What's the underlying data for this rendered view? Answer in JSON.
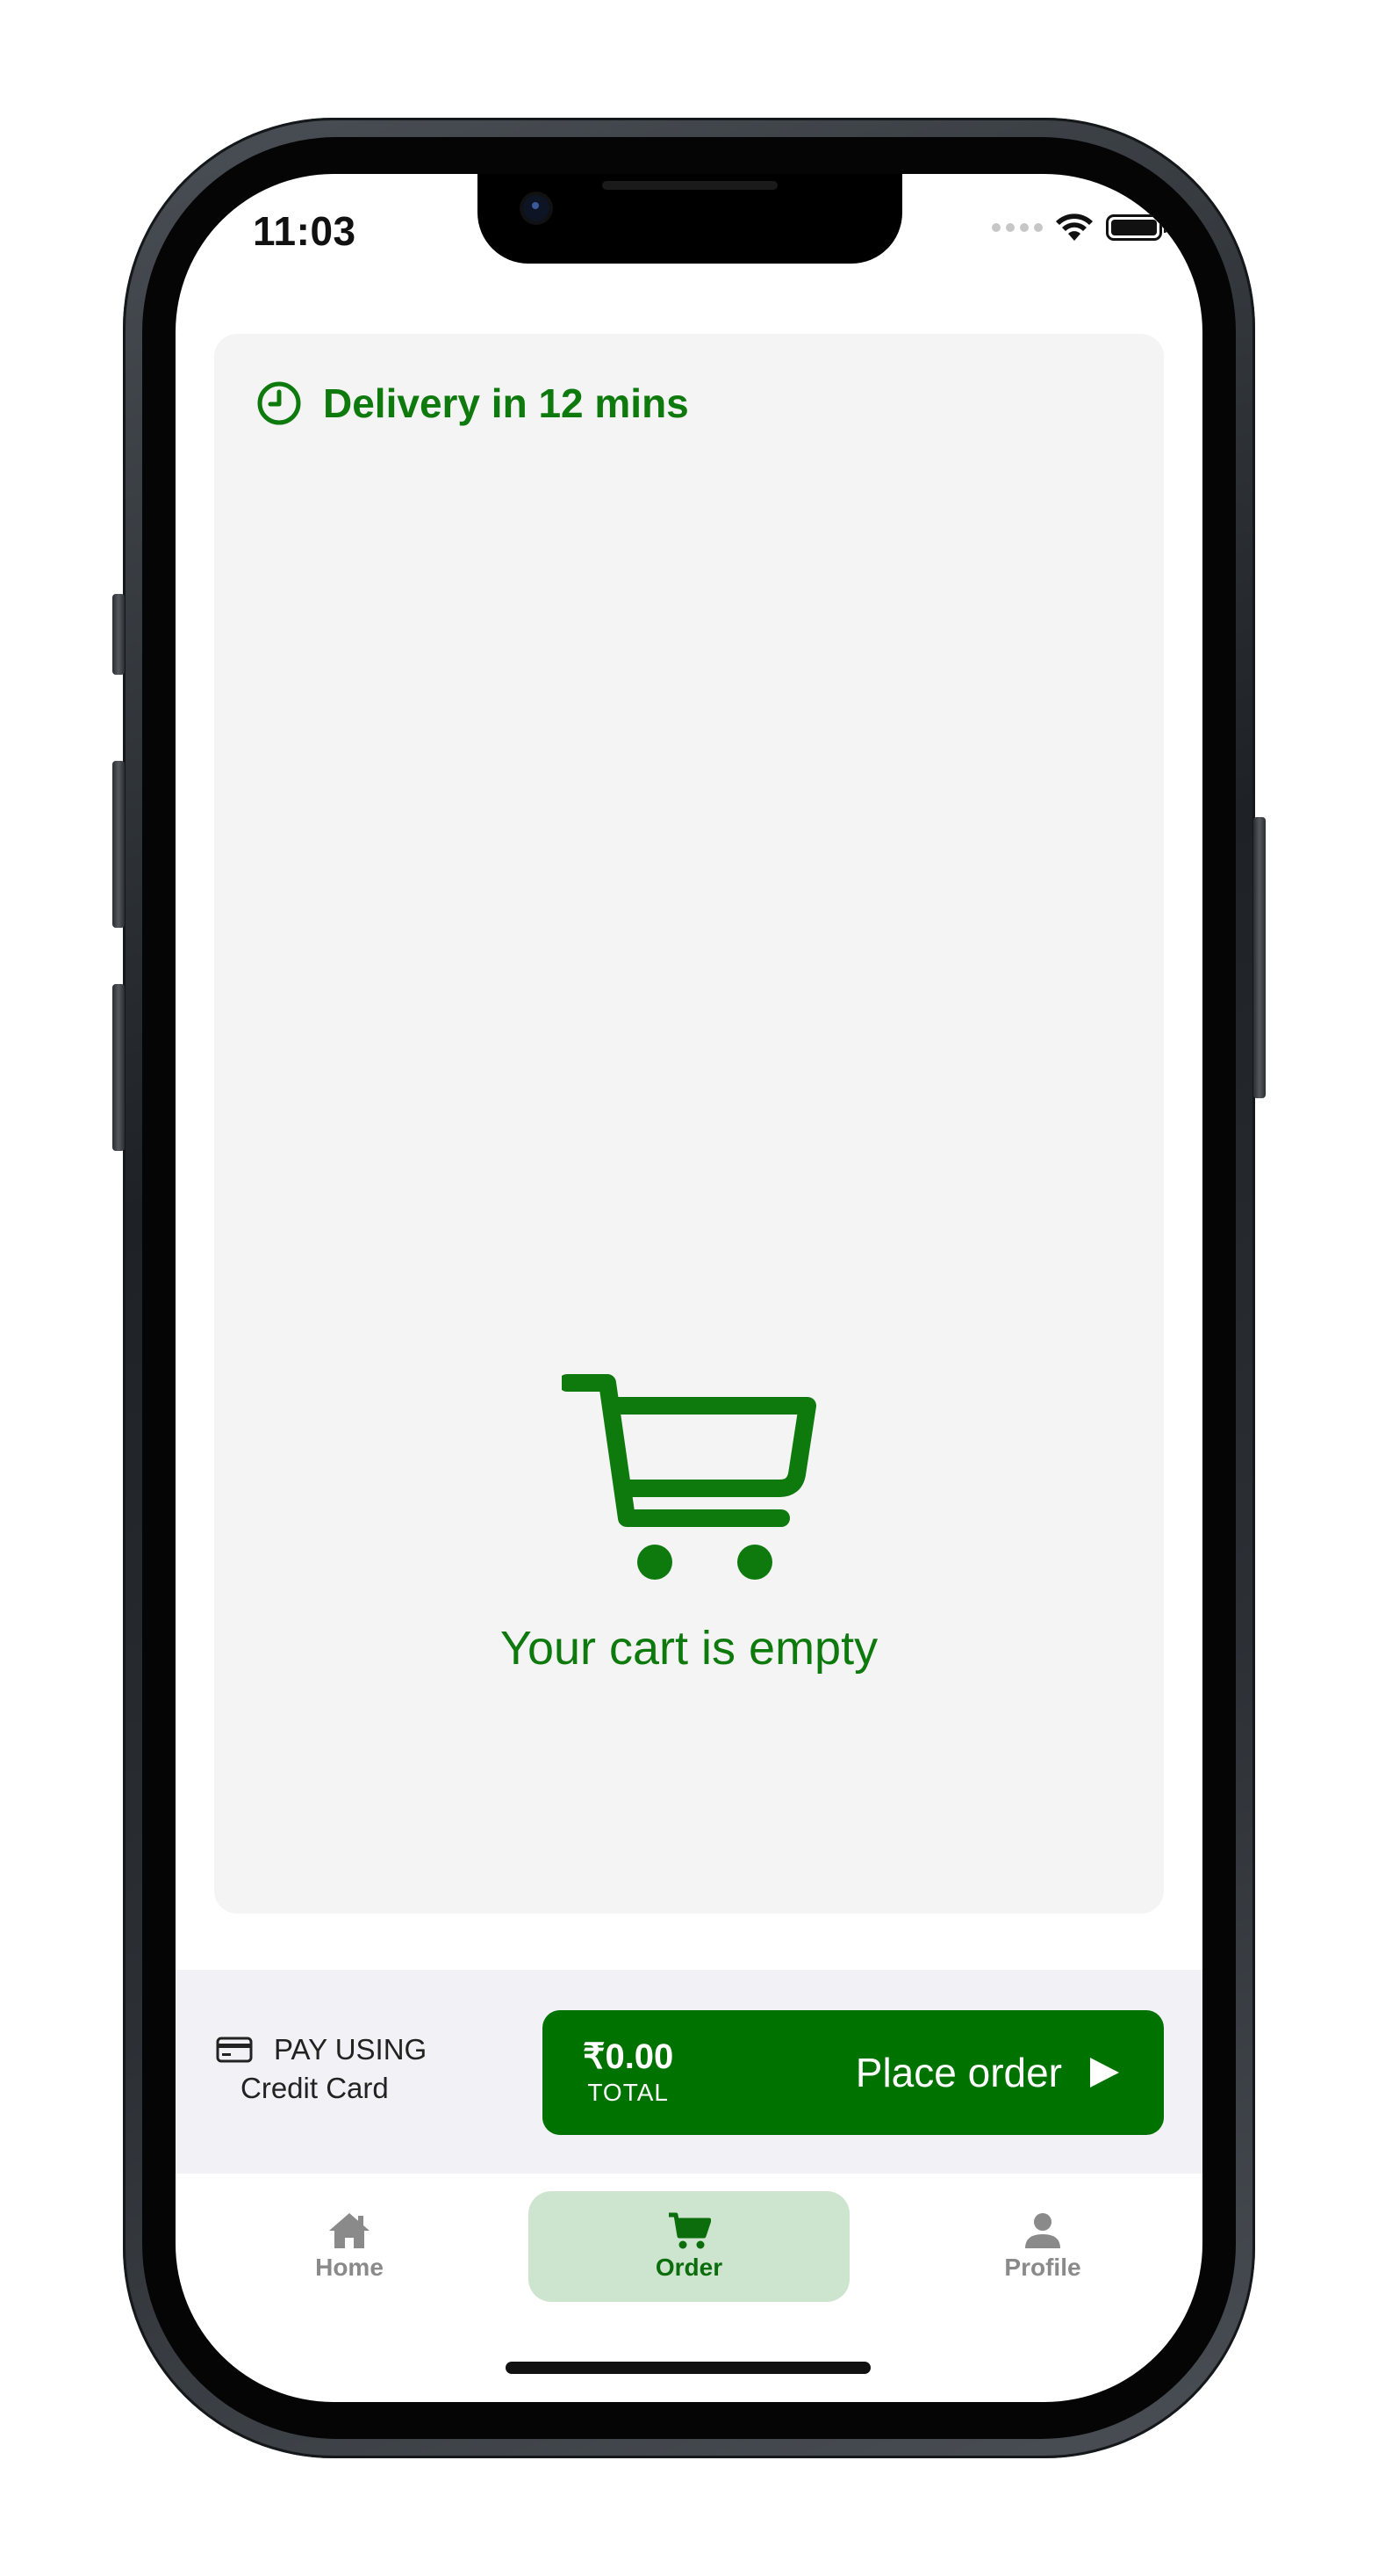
{
  "status_bar": {
    "time": "11:03"
  },
  "delivery": {
    "label": "Delivery in 12 mins",
    "icon": "clock-icon"
  },
  "cart": {
    "empty_message": "Your cart is empty",
    "icon": "cart-icon"
  },
  "payment": {
    "label": "PAY USING",
    "method": "Credit Card",
    "icon": "credit-card-icon"
  },
  "order_button": {
    "amount": "₹0.00",
    "total_label": "TOTAL",
    "label": "Place order",
    "icon": "play-arrow-icon"
  },
  "tabs": [
    {
      "label": "Home",
      "icon": "home-icon",
      "active": false
    },
    {
      "label": "Order",
      "icon": "cart-icon",
      "active": true
    },
    {
      "label": "Profile",
      "icon": "person-icon",
      "active": false
    }
  ],
  "colors": {
    "accent": "#0e7a0d",
    "button": "#007200",
    "active_tab_bg": "#cde4cf",
    "card_bg": "#f4f4f5"
  }
}
